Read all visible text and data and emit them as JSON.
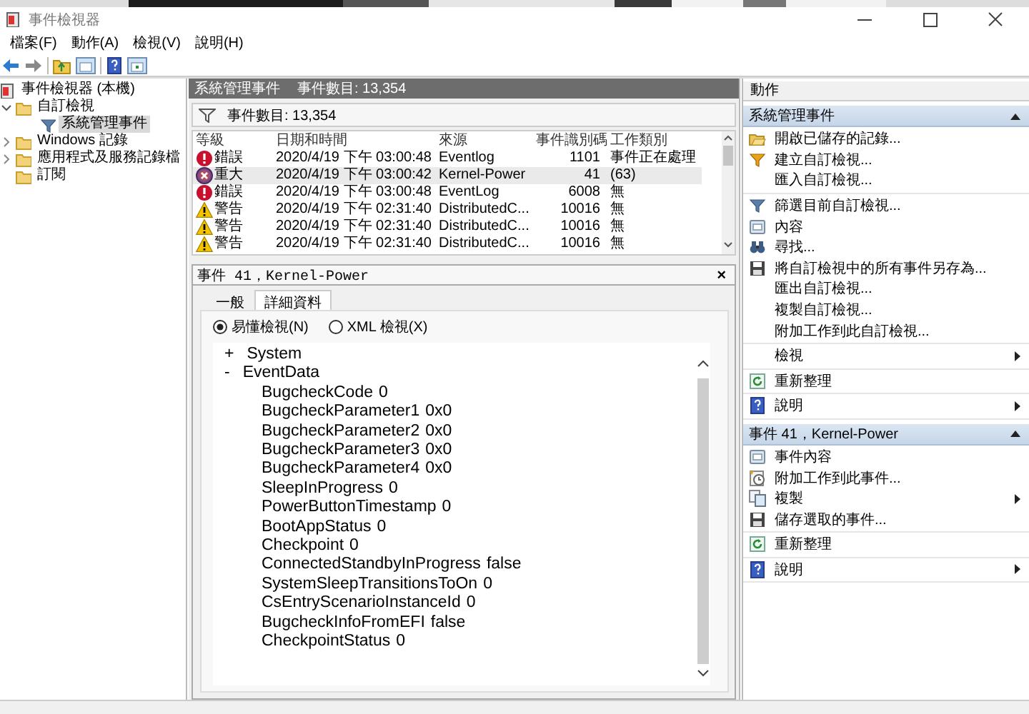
{
  "window": {
    "title": "事件檢視器"
  },
  "menu": [
    "檔案(F)",
    "動作(A)",
    "檢視(V)",
    "說明(H)"
  ],
  "tree": [
    {
      "label": "事件檢視器 (本機)",
      "kind": "viewer",
      "selected": false,
      "children": [
        {
          "label": "自訂檢視",
          "kind": "folder",
          "expanded": true,
          "selected": false,
          "children": [
            {
              "label": "系統管理事件",
              "kind": "filter",
              "selected": true
            }
          ]
        },
        {
          "label": "Windows 記錄",
          "kind": "folder",
          "expanded": false,
          "selected": false
        },
        {
          "label": "應用程式及服務記錄檔",
          "kind": "folder",
          "expanded": false,
          "selected": false
        },
        {
          "label": "訂閱",
          "kind": "folder",
          "selected": false
        }
      ]
    }
  ],
  "center": {
    "title": "系統管理事件",
    "count": "事件數目: 13,354",
    "filter_count": "事件數目: 13,354",
    "table": {
      "columns": [
        "等級",
        "日期和時間",
        "來源",
        "事件識別碼",
        "工作類別"
      ],
      "rows": [
        {
          "kind": "error",
          "level": "錯誤",
          "date": "2020/4/19 下午 03:00:48",
          "source": "Eventlog",
          "id": "1101",
          "category": "事件正在處理",
          "selected": false
        },
        {
          "kind": "critical",
          "level": "重大",
          "date": "2020/4/19 下午 03:00:42",
          "source": "Kernel-Power",
          "id": "41",
          "category": "(63)",
          "selected": true
        },
        {
          "kind": "error",
          "level": "錯誤",
          "date": "2020/4/19 下午 03:00:48",
          "source": "EventLog",
          "id": "6008",
          "category": "無",
          "selected": false
        },
        {
          "kind": "warning",
          "level": "警告",
          "date": "2020/4/19 下午 02:31:40",
          "source": "DistributedC...",
          "id": "10016",
          "category": "無",
          "selected": false
        },
        {
          "kind": "warning",
          "level": "警告",
          "date": "2020/4/19 下午 02:31:40",
          "source": "DistributedC...",
          "id": "10016",
          "category": "無",
          "selected": false
        },
        {
          "kind": "warning",
          "level": "警告",
          "date": "2020/4/19 下午 02:31:40",
          "source": "DistributedC...",
          "id": "10016",
          "category": "無",
          "selected": false
        }
      ]
    },
    "detail": {
      "title": "事件 41，Kernel-Power",
      "close": "×",
      "tabs": [
        {
          "label": "一般",
          "selected": false
        },
        {
          "label": "詳細資料",
          "selected": true
        }
      ],
      "views": [
        {
          "label": "易懂檢視(N)",
          "selected": true
        },
        {
          "label": "XML 檢視(X)",
          "selected": false
        }
      ],
      "nodes": [
        {
          "toggle": "+",
          "label": "System"
        },
        {
          "toggle": "-",
          "label": "EventData",
          "fields": [
            {
              "name": "BugcheckCode",
              "value": "0"
            },
            {
              "name": "BugcheckParameter1",
              "value": "0x0"
            },
            {
              "name": "BugcheckParameter2",
              "value": "0x0"
            },
            {
              "name": "BugcheckParameter3",
              "value": "0x0"
            },
            {
              "name": "BugcheckParameter4",
              "value": "0x0"
            },
            {
              "name": "SleepInProgress",
              "value": "0"
            },
            {
              "name": "PowerButtonTimestamp",
              "value": "0"
            },
            {
              "name": "BootAppStatus",
              "value": "0"
            },
            {
              "name": "Checkpoint",
              "value": "0"
            },
            {
              "name": "ConnectedStandbyInProgress",
              "value": "false"
            },
            {
              "name": "SystemSleepTransitionsToOn",
              "value": "0"
            },
            {
              "name": "CsEntryScenarioInstanceId",
              "value": "0"
            },
            {
              "name": "BugcheckInfoFromEFI",
              "value": "false"
            },
            {
              "name": "CheckpointStatus",
              "value": "0"
            }
          ]
        }
      ]
    }
  },
  "actions": {
    "title": "動作",
    "sections": [
      {
        "title": "系統管理事件",
        "expanded": true,
        "groups": [
          [
            {
              "label": "開啟已儲存的記錄...",
              "kind": "open"
            },
            {
              "label": "建立自訂檢視...",
              "kind": "create"
            },
            {
              "label": "匯入自訂檢視..."
            }
          ],
          [
            {
              "label": "篩選目前自訂檢視...",
              "kind": "filter"
            },
            {
              "label": "內容",
              "kind": "properties"
            },
            {
              "label": "尋找...",
              "kind": "find"
            },
            {
              "label": "將自訂檢視中的所有事件另存為...",
              "kind": "save"
            },
            {
              "label": "匯出自訂檢視..."
            },
            {
              "label": "複製自訂檢視..."
            },
            {
              "label": "附加工作到此自訂檢視..."
            }
          ],
          [
            {
              "label": "檢視",
              "submenu": true
            }
          ],
          [
            {
              "label": "重新整理",
              "kind": "refresh"
            }
          ],
          [
            {
              "label": "說明",
              "kind": "help",
              "submenu": true
            }
          ]
        ]
      },
      {
        "title": "事件 41，Kernel-Power",
        "expanded": true,
        "groups": [
          [
            {
              "label": "事件內容",
              "kind": "properties"
            },
            {
              "label": "附加工作到此事件...",
              "kind": "task"
            },
            {
              "label": "複製",
              "kind": "copy",
              "submenu": true
            },
            {
              "label": "儲存選取的事件...",
              "kind": "save"
            }
          ],
          [
            {
              "label": "重新整理",
              "kind": "refresh"
            }
          ],
          [
            {
              "label": "說明",
              "kind": "help",
              "submenu": true
            }
          ]
        ]
      }
    ]
  }
}
